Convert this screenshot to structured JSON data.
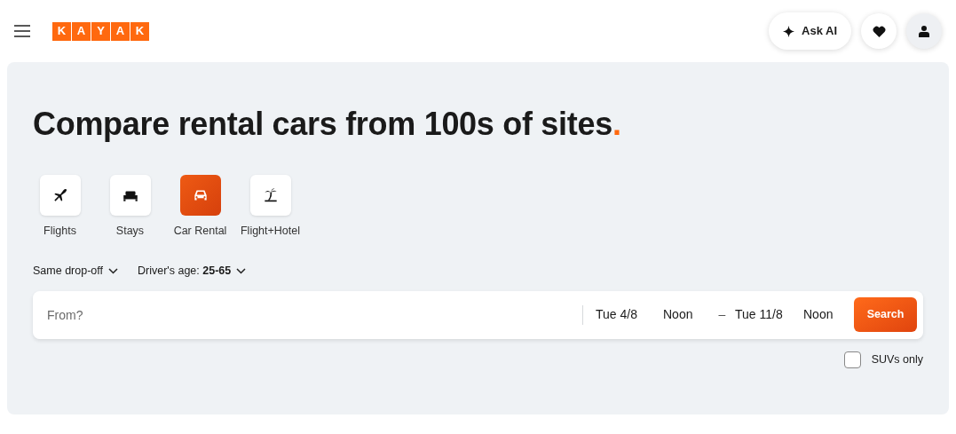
{
  "header": {
    "logo_letters": [
      "K",
      "A",
      "Y",
      "A",
      "K"
    ],
    "ask_ai": "Ask AI"
  },
  "title": "Compare rental cars from 100s of sites.",
  "tabs": [
    {
      "label": "Flights",
      "kind": "plane",
      "selected": false
    },
    {
      "label": "Stays",
      "kind": "bed",
      "selected": false
    },
    {
      "label": "Car Rental",
      "kind": "car",
      "selected": true
    },
    {
      "label": "Flight+Hotel",
      "kind": "palm",
      "selected": false
    }
  ],
  "options": [
    "Same drop-off",
    "Driver's age: **25-65**"
  ],
  "search": {
    "placeholder": "From?",
    "start_date": "Tue 4/8",
    "start_time": "Noon",
    "separator": "–",
    "end_date": "Tue 11/8",
    "end_time": "Noon",
    "button": "Search"
  },
  "suv_filter": {
    "label": "SUVs only",
    "checked": false
  }
}
